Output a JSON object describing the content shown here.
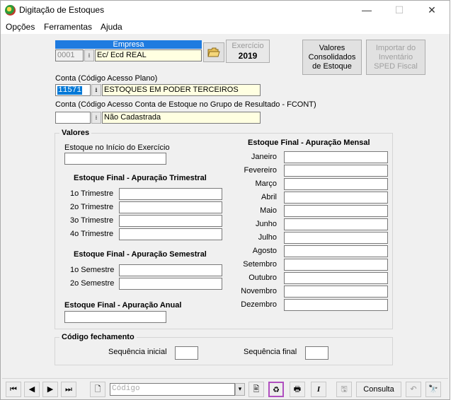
{
  "window": {
    "title": "Digitação de Estoques",
    "minimize": "—",
    "maximize": "☐",
    "close": "✕"
  },
  "menu": [
    "Opções",
    "Ferramentas",
    "Ajuda"
  ],
  "empresa": {
    "label": "Empresa",
    "code": "0001",
    "name": "Ec/ Ecd REAL"
  },
  "exercicio": {
    "label": "Exercício",
    "value": "2019"
  },
  "buttons": {
    "valores_consolidados": "Valores Consolidados de Estoque",
    "importar_inventario": "Importar do Inventário SPED Fiscal"
  },
  "conta": {
    "label": "Conta (Código Acesso Plano)",
    "code": "11571",
    "name": "ESTOQUES EM PODER TERCEIROS"
  },
  "conta_fcont": {
    "label": "Conta (Código Acesso Conta de Estoque no Grupo de Resultado - FCONT)",
    "code": "",
    "name": "Não Cadastrada"
  },
  "valores": {
    "title": "Valores",
    "inicio_label": "Estoque no Início do Exercício",
    "trimestral_title": "Estoque Final - Apuração Trimestral",
    "trimestres": [
      "1o Trimestre",
      "2o Trimestre",
      "3o Trimestre",
      "4o Trimestre"
    ],
    "semestral_title": "Estoque Final - Apuração Semestral",
    "semestres": [
      "1o Semestre",
      "2o Semestre"
    ],
    "anual_title": "Estoque Final - Apuração Anual",
    "mensal_title": "Estoque Final - Apuração Mensal",
    "meses": [
      "Janeiro",
      "Fevereiro",
      "Março",
      "Abril",
      "Maio",
      "Junho",
      "Julho",
      "Agosto",
      "Setembro",
      "Outubro",
      "Novembro",
      "Dezembro"
    ]
  },
  "fechamento": {
    "title": "Código fechamento",
    "seq_inicial": "Sequência inicial",
    "seq_final": "Sequência final"
  },
  "toolbar": {
    "search_placeholder": "Código",
    "consulta": "Consulta"
  },
  "colors": {
    "highlight": "#b04fc0",
    "selection": "#0078d7",
    "yellow_field": "#ffffe1",
    "empresa_header": "#1e7be0"
  }
}
